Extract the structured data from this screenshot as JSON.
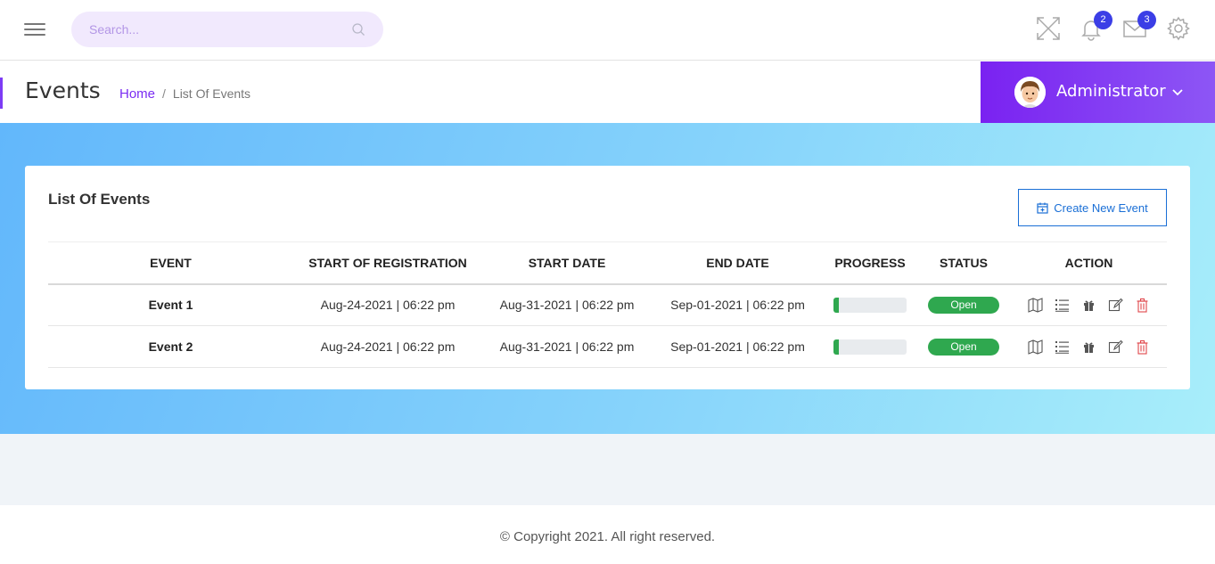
{
  "topbar": {
    "search_placeholder": "Search...",
    "notifications_count": "2",
    "messages_count": "3"
  },
  "header": {
    "title": "Events",
    "breadcrumb_home": "Home",
    "breadcrumb_current": "List Of Events",
    "user_name": "Administrator"
  },
  "card": {
    "title": "List Of Events",
    "create_button": "Create New Event",
    "columns": [
      "EVENT",
      "START OF REGISTRATION",
      "START DATE",
      "END DATE",
      "PROGRESS",
      "STATUS",
      "ACTION"
    ],
    "rows": [
      {
        "event": "Event 1",
        "registration": "Aug-24-2021 | 06:22 pm",
        "start": "Aug-31-2021 | 06:22 pm",
        "end": "Sep-01-2021 | 06:22 pm",
        "progress": 0.07,
        "status": "Open"
      },
      {
        "event": "Event 2",
        "registration": "Aug-24-2021 | 06:22 pm",
        "start": "Aug-31-2021 | 06:22 pm",
        "end": "Sep-01-2021 | 06:22 pm",
        "progress": 0.07,
        "status": "Open"
      }
    ]
  },
  "footer": {
    "copyright": "© Copyright 2021. All right reserved."
  },
  "colors": {
    "accent": "#7a22f1",
    "link": "#1a6fd6",
    "status_open": "#2fa84f",
    "badge": "#3b3ee6",
    "delete": "#e0464b"
  }
}
